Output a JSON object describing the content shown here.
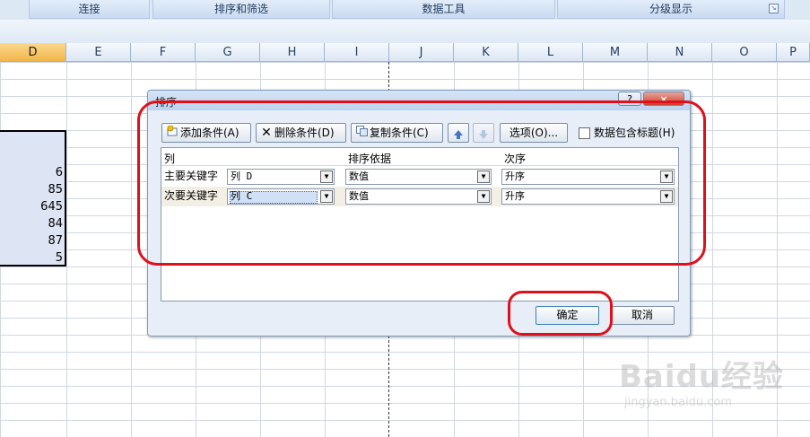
{
  "ribbon": {
    "groups": [
      "连接",
      "排序和筛选",
      "数据工具",
      "分级显示"
    ]
  },
  "sheet": {
    "columns": [
      "D",
      "E",
      "F",
      "G",
      "H",
      "I",
      "J",
      "K",
      "L",
      "M",
      "N",
      "O",
      "P"
    ],
    "selected_column": "D",
    "cell_values": [
      "6",
      "85",
      "645",
      "84",
      "87",
      "5"
    ]
  },
  "dialog": {
    "title": "排序",
    "help_label": "?",
    "close_label": "×",
    "toolbar": {
      "add_label": "添加条件(A)",
      "delete_label": "删除条件(D)",
      "copy_label": "复制条件(C)",
      "options_label": "选项(O)...",
      "header_checkbox_label": "数据包含标题(H)"
    },
    "table": {
      "headers": [
        "列",
        "排序依据",
        "次序"
      ],
      "rows": [
        {
          "label": "主要关键字",
          "column": "列 D",
          "basis": "数值",
          "order": "升序"
        },
        {
          "label": "次要关键字",
          "column": "列 C",
          "basis": "数值",
          "order": "升序"
        }
      ]
    },
    "ok_label": "确定",
    "cancel_label": "取消"
  },
  "watermark": {
    "brand": "Baidu经验",
    "url": "jingyan.baidu.com"
  },
  "colors": {
    "annotation": "#e0101a",
    "ribbon": "#c9daf0",
    "selection": "#dde4f3"
  }
}
